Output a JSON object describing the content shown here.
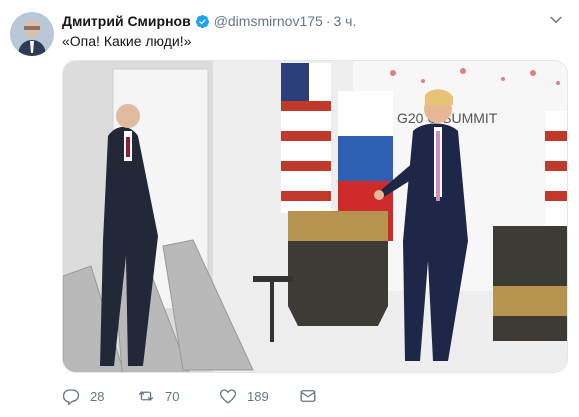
{
  "user": {
    "name": "Дмитрий Смирнов",
    "handle": "@dimsmirnov175",
    "time": "3 ч."
  },
  "tweet": {
    "text": "«Опа! Какие люди!»"
  },
  "media": {
    "banner_text": "G20 O   SUMMIT"
  },
  "actions": {
    "replies": "28",
    "retweets": "70",
    "likes": "189"
  },
  "colors": {
    "verified": "#1da1f2",
    "meta": "#657786"
  }
}
